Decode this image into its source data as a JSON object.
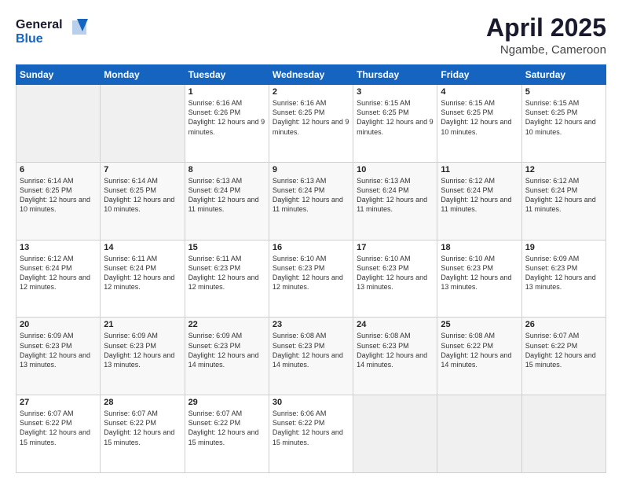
{
  "logo": {
    "general": "General",
    "blue": "Blue"
  },
  "header": {
    "title": "April 2025",
    "subtitle": "Ngambe, Cameroon"
  },
  "weekdays": [
    "Sunday",
    "Monday",
    "Tuesday",
    "Wednesday",
    "Thursday",
    "Friday",
    "Saturday"
  ],
  "weeks": [
    [
      {
        "day": "",
        "info": ""
      },
      {
        "day": "",
        "info": ""
      },
      {
        "day": "1",
        "info": "Sunrise: 6:16 AM\nSunset: 6:26 PM\nDaylight: 12 hours and 9 minutes."
      },
      {
        "day": "2",
        "info": "Sunrise: 6:16 AM\nSunset: 6:25 PM\nDaylight: 12 hours and 9 minutes."
      },
      {
        "day": "3",
        "info": "Sunrise: 6:15 AM\nSunset: 6:25 PM\nDaylight: 12 hours and 9 minutes."
      },
      {
        "day": "4",
        "info": "Sunrise: 6:15 AM\nSunset: 6:25 PM\nDaylight: 12 hours and 10 minutes."
      },
      {
        "day": "5",
        "info": "Sunrise: 6:15 AM\nSunset: 6:25 PM\nDaylight: 12 hours and 10 minutes."
      }
    ],
    [
      {
        "day": "6",
        "info": "Sunrise: 6:14 AM\nSunset: 6:25 PM\nDaylight: 12 hours and 10 minutes."
      },
      {
        "day": "7",
        "info": "Sunrise: 6:14 AM\nSunset: 6:25 PM\nDaylight: 12 hours and 10 minutes."
      },
      {
        "day": "8",
        "info": "Sunrise: 6:13 AM\nSunset: 6:24 PM\nDaylight: 12 hours and 11 minutes."
      },
      {
        "day": "9",
        "info": "Sunrise: 6:13 AM\nSunset: 6:24 PM\nDaylight: 12 hours and 11 minutes."
      },
      {
        "day": "10",
        "info": "Sunrise: 6:13 AM\nSunset: 6:24 PM\nDaylight: 12 hours and 11 minutes."
      },
      {
        "day": "11",
        "info": "Sunrise: 6:12 AM\nSunset: 6:24 PM\nDaylight: 12 hours and 11 minutes."
      },
      {
        "day": "12",
        "info": "Sunrise: 6:12 AM\nSunset: 6:24 PM\nDaylight: 12 hours and 11 minutes."
      }
    ],
    [
      {
        "day": "13",
        "info": "Sunrise: 6:12 AM\nSunset: 6:24 PM\nDaylight: 12 hours and 12 minutes."
      },
      {
        "day": "14",
        "info": "Sunrise: 6:11 AM\nSunset: 6:24 PM\nDaylight: 12 hours and 12 minutes."
      },
      {
        "day": "15",
        "info": "Sunrise: 6:11 AM\nSunset: 6:23 PM\nDaylight: 12 hours and 12 minutes."
      },
      {
        "day": "16",
        "info": "Sunrise: 6:10 AM\nSunset: 6:23 PM\nDaylight: 12 hours and 12 minutes."
      },
      {
        "day": "17",
        "info": "Sunrise: 6:10 AM\nSunset: 6:23 PM\nDaylight: 12 hours and 13 minutes."
      },
      {
        "day": "18",
        "info": "Sunrise: 6:10 AM\nSunset: 6:23 PM\nDaylight: 12 hours and 13 minutes."
      },
      {
        "day": "19",
        "info": "Sunrise: 6:09 AM\nSunset: 6:23 PM\nDaylight: 12 hours and 13 minutes."
      }
    ],
    [
      {
        "day": "20",
        "info": "Sunrise: 6:09 AM\nSunset: 6:23 PM\nDaylight: 12 hours and 13 minutes."
      },
      {
        "day": "21",
        "info": "Sunrise: 6:09 AM\nSunset: 6:23 PM\nDaylight: 12 hours and 13 minutes."
      },
      {
        "day": "22",
        "info": "Sunrise: 6:09 AM\nSunset: 6:23 PM\nDaylight: 12 hours and 14 minutes."
      },
      {
        "day": "23",
        "info": "Sunrise: 6:08 AM\nSunset: 6:23 PM\nDaylight: 12 hours and 14 minutes."
      },
      {
        "day": "24",
        "info": "Sunrise: 6:08 AM\nSunset: 6:23 PM\nDaylight: 12 hours and 14 minutes."
      },
      {
        "day": "25",
        "info": "Sunrise: 6:08 AM\nSunset: 6:22 PM\nDaylight: 12 hours and 14 minutes."
      },
      {
        "day": "26",
        "info": "Sunrise: 6:07 AM\nSunset: 6:22 PM\nDaylight: 12 hours and 15 minutes."
      }
    ],
    [
      {
        "day": "27",
        "info": "Sunrise: 6:07 AM\nSunset: 6:22 PM\nDaylight: 12 hours and 15 minutes."
      },
      {
        "day": "28",
        "info": "Sunrise: 6:07 AM\nSunset: 6:22 PM\nDaylight: 12 hours and 15 minutes."
      },
      {
        "day": "29",
        "info": "Sunrise: 6:07 AM\nSunset: 6:22 PM\nDaylight: 12 hours and 15 minutes."
      },
      {
        "day": "30",
        "info": "Sunrise: 6:06 AM\nSunset: 6:22 PM\nDaylight: 12 hours and 15 minutes."
      },
      {
        "day": "",
        "info": ""
      },
      {
        "day": "",
        "info": ""
      },
      {
        "day": "",
        "info": ""
      }
    ]
  ]
}
